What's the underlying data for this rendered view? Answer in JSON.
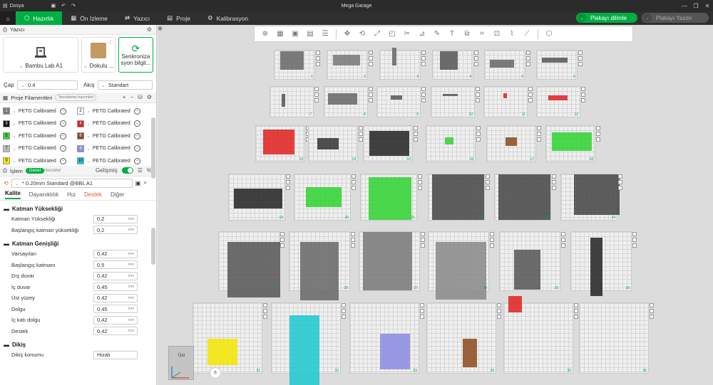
{
  "titlebar": {
    "file_menu": "Dosya",
    "title": "Mega Garage"
  },
  "menu": {
    "tabs": [
      {
        "label": "Hazırlık"
      },
      {
        "label": "Ön İzleme"
      },
      {
        "label": "Yazıcı"
      },
      {
        "label": "Proje"
      },
      {
        "label": "Kalibrasyon"
      }
    ],
    "slice_button": "Plakayı dilimle",
    "print_button": "Plakayı Yazdır"
  },
  "printer": {
    "header": "Yazıcı",
    "printer_name": "Bambu Lab A1",
    "plate_name": "Dokulu ...",
    "sync_label_1": "Senkroniza",
    "sync_label_2": "syon bilgil...",
    "nozzle_label": "Çap",
    "nozzle_value": "0.4",
    "flow_label": "Akış",
    "flow_value": "Standart"
  },
  "filaments": {
    "header": "Proje Filamentleri",
    "clean_chip": "Temizleme hacimleri",
    "items": [
      {
        "num": "1",
        "name": "PETG Calibrated",
        "color": "#7a7a7a"
      },
      {
        "num": "2",
        "name": "PETG Calibrated",
        "color": "#ffffff"
      },
      {
        "num": "3",
        "name": "PETG Calibrated",
        "color": "#111111"
      },
      {
        "num": "4",
        "name": "PETG Calibrated",
        "color": "#e02020"
      },
      {
        "num": "5",
        "name": "PETG Calibrated",
        "color": "#2fd42f"
      },
      {
        "num": "6",
        "name": "PETG Calibrated",
        "color": "#8b4a1a"
      },
      {
        "num": "7",
        "name": "PETG Calibrated",
        "color": "#bdbdbd"
      },
      {
        "num": "8",
        "name": "PETG Calibrated",
        "color": "#8a8ae0"
      },
      {
        "num": "9",
        "name": "PETG Calibrated",
        "color": "#f5e600"
      },
      {
        "num": "10",
        "name": "PETG Calibrated",
        "color": "#19c9d0"
      }
    ]
  },
  "process": {
    "header": "İşlem",
    "tab_general": "Genel",
    "tab_objects": "Nesneler",
    "advanced": "Gelişmiş",
    "preset": "* 0.20mm Standard @BBL A1",
    "tabs": [
      "Kalite",
      "Dayanıklılık",
      "Hız",
      "Destek",
      "Diğer"
    ],
    "groups": [
      {
        "title": "Katman Yüksekliği",
        "rows": [
          {
            "label": "Katman Yüksekliği",
            "value": "0,2",
            "unit": "mm"
          },
          {
            "label": "Başlangıç katman yüksekliği",
            "value": "0,2",
            "unit": "mm"
          }
        ]
      },
      {
        "title": "Katman Genişliği",
        "rows": [
          {
            "label": "Varsayılan",
            "value": "0,42",
            "unit": "mm"
          },
          {
            "label": "Başlangıç katmanı",
            "value": "0,5",
            "unit": "mm"
          },
          {
            "label": "Dış duvar",
            "value": "0,42",
            "unit": "mm"
          },
          {
            "label": "İç duvar",
            "value": "0,45",
            "unit": "mm"
          },
          {
            "label": "Üst yüzey",
            "value": "0,42",
            "unit": "mm"
          },
          {
            "label": "Dolgu",
            "value": "0,45",
            "unit": "mm"
          },
          {
            "label": "İç katı dolgu",
            "value": "0,42",
            "unit": "mm"
          },
          {
            "label": "Destek",
            "value": "0,42",
            "unit": "mm"
          }
        ]
      },
      {
        "title": "Dikiş",
        "rows": [
          {
            "label": "Dikiş konumu",
            "value": "Hizalı",
            "unit": ""
          }
        ]
      }
    ]
  },
  "viewport": {
    "axis_label": "Üst",
    "plate_numbers": [
      "1",
      "2",
      "3",
      "4",
      "5",
      "6",
      "7",
      "8",
      "9",
      "10",
      "11",
      "12",
      "13",
      "14",
      "15",
      "16",
      "17",
      "18",
      "19",
      "20",
      "21",
      "22",
      "23",
      "24",
      "25",
      "26",
      "27",
      "28",
      "29",
      "30",
      "31",
      "32",
      "33",
      "34",
      "35",
      "36"
    ]
  },
  "colors": {
    "accent": "#00ae42",
    "menubar": "#2f2f2f",
    "titlebar": "#2b2b2b"
  }
}
